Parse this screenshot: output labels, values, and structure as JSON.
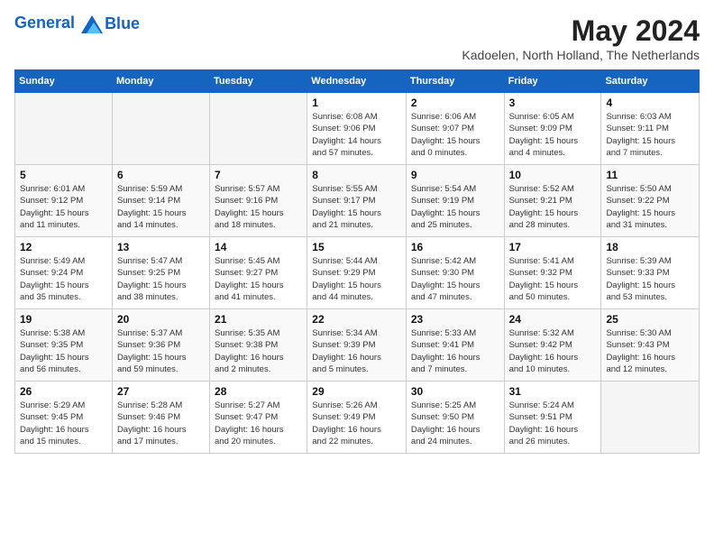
{
  "header": {
    "logo_line1": "General",
    "logo_line2": "Blue",
    "month_year": "May 2024",
    "location": "Kadoelen, North Holland, The Netherlands"
  },
  "days_of_week": [
    "Sunday",
    "Monday",
    "Tuesday",
    "Wednesday",
    "Thursday",
    "Friday",
    "Saturday"
  ],
  "weeks": [
    [
      {
        "day": "",
        "info": ""
      },
      {
        "day": "",
        "info": ""
      },
      {
        "day": "",
        "info": ""
      },
      {
        "day": "1",
        "info": "Sunrise: 6:08 AM\nSunset: 9:06 PM\nDaylight: 14 hours\nand 57 minutes."
      },
      {
        "day": "2",
        "info": "Sunrise: 6:06 AM\nSunset: 9:07 PM\nDaylight: 15 hours\nand 0 minutes."
      },
      {
        "day": "3",
        "info": "Sunrise: 6:05 AM\nSunset: 9:09 PM\nDaylight: 15 hours\nand 4 minutes."
      },
      {
        "day": "4",
        "info": "Sunrise: 6:03 AM\nSunset: 9:11 PM\nDaylight: 15 hours\nand 7 minutes."
      }
    ],
    [
      {
        "day": "5",
        "info": "Sunrise: 6:01 AM\nSunset: 9:12 PM\nDaylight: 15 hours\nand 11 minutes."
      },
      {
        "day": "6",
        "info": "Sunrise: 5:59 AM\nSunset: 9:14 PM\nDaylight: 15 hours\nand 14 minutes."
      },
      {
        "day": "7",
        "info": "Sunrise: 5:57 AM\nSunset: 9:16 PM\nDaylight: 15 hours\nand 18 minutes."
      },
      {
        "day": "8",
        "info": "Sunrise: 5:55 AM\nSunset: 9:17 PM\nDaylight: 15 hours\nand 21 minutes."
      },
      {
        "day": "9",
        "info": "Sunrise: 5:54 AM\nSunset: 9:19 PM\nDaylight: 15 hours\nand 25 minutes."
      },
      {
        "day": "10",
        "info": "Sunrise: 5:52 AM\nSunset: 9:21 PM\nDaylight: 15 hours\nand 28 minutes."
      },
      {
        "day": "11",
        "info": "Sunrise: 5:50 AM\nSunset: 9:22 PM\nDaylight: 15 hours\nand 31 minutes."
      }
    ],
    [
      {
        "day": "12",
        "info": "Sunrise: 5:49 AM\nSunset: 9:24 PM\nDaylight: 15 hours\nand 35 minutes."
      },
      {
        "day": "13",
        "info": "Sunrise: 5:47 AM\nSunset: 9:25 PM\nDaylight: 15 hours\nand 38 minutes."
      },
      {
        "day": "14",
        "info": "Sunrise: 5:45 AM\nSunset: 9:27 PM\nDaylight: 15 hours\nand 41 minutes."
      },
      {
        "day": "15",
        "info": "Sunrise: 5:44 AM\nSunset: 9:29 PM\nDaylight: 15 hours\nand 44 minutes."
      },
      {
        "day": "16",
        "info": "Sunrise: 5:42 AM\nSunset: 9:30 PM\nDaylight: 15 hours\nand 47 minutes."
      },
      {
        "day": "17",
        "info": "Sunrise: 5:41 AM\nSunset: 9:32 PM\nDaylight: 15 hours\nand 50 minutes."
      },
      {
        "day": "18",
        "info": "Sunrise: 5:39 AM\nSunset: 9:33 PM\nDaylight: 15 hours\nand 53 minutes."
      }
    ],
    [
      {
        "day": "19",
        "info": "Sunrise: 5:38 AM\nSunset: 9:35 PM\nDaylight: 15 hours\nand 56 minutes."
      },
      {
        "day": "20",
        "info": "Sunrise: 5:37 AM\nSunset: 9:36 PM\nDaylight: 15 hours\nand 59 minutes."
      },
      {
        "day": "21",
        "info": "Sunrise: 5:35 AM\nSunset: 9:38 PM\nDaylight: 16 hours\nand 2 minutes."
      },
      {
        "day": "22",
        "info": "Sunrise: 5:34 AM\nSunset: 9:39 PM\nDaylight: 16 hours\nand 5 minutes."
      },
      {
        "day": "23",
        "info": "Sunrise: 5:33 AM\nSunset: 9:41 PM\nDaylight: 16 hours\nand 7 minutes."
      },
      {
        "day": "24",
        "info": "Sunrise: 5:32 AM\nSunset: 9:42 PM\nDaylight: 16 hours\nand 10 minutes."
      },
      {
        "day": "25",
        "info": "Sunrise: 5:30 AM\nSunset: 9:43 PM\nDaylight: 16 hours\nand 12 minutes."
      }
    ],
    [
      {
        "day": "26",
        "info": "Sunrise: 5:29 AM\nSunset: 9:45 PM\nDaylight: 16 hours\nand 15 minutes."
      },
      {
        "day": "27",
        "info": "Sunrise: 5:28 AM\nSunset: 9:46 PM\nDaylight: 16 hours\nand 17 minutes."
      },
      {
        "day": "28",
        "info": "Sunrise: 5:27 AM\nSunset: 9:47 PM\nDaylight: 16 hours\nand 20 minutes."
      },
      {
        "day": "29",
        "info": "Sunrise: 5:26 AM\nSunset: 9:49 PM\nDaylight: 16 hours\nand 22 minutes."
      },
      {
        "day": "30",
        "info": "Sunrise: 5:25 AM\nSunset: 9:50 PM\nDaylight: 16 hours\nand 24 minutes."
      },
      {
        "day": "31",
        "info": "Sunrise: 5:24 AM\nSunset: 9:51 PM\nDaylight: 16 hours\nand 26 minutes."
      },
      {
        "day": "",
        "info": ""
      }
    ]
  ]
}
